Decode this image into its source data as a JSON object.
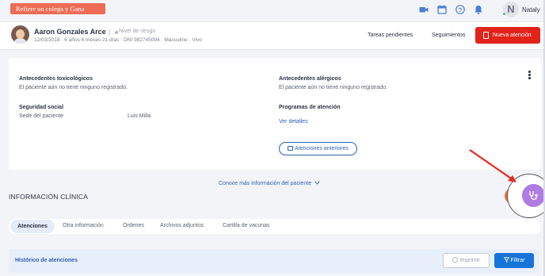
{
  "topnav": {
    "referral_banner": "Refiere un colega y Gana",
    "icons": [
      "video-icon",
      "calendar-icon",
      "help-icon",
      "bell-icon"
    ],
    "user_initial": "N",
    "user_name": "Nataly"
  },
  "patient": {
    "name": "Aaron Gonzales Arce",
    "separator": "|",
    "risk_label": "Nivel de riesgo",
    "meta": "12/03/2018 · 6 años 6 meses 21 días · DNI 982745094 · Masculino · Vivo",
    "pending_tasks": "Tareas pendientes",
    "follow_ups": "Seguimientos",
    "new_attention": "Nueva atención"
  },
  "info": {
    "toxic_title": "Antecedentes toxicológicos",
    "toxic_text": "El paciente aún no tiene ninguno registrado.",
    "allergic_title": "Antecedentes alérgicos",
    "allergic_text": "El paciente aún no tiene ninguno registrado.",
    "social_title": "Seguridad social",
    "social_label": "Sede del paciente",
    "social_value": "Luis Milla",
    "programs_title": "Programas de atención",
    "see_details": "Ver detalles",
    "previous_attentions": "Atenciones anteriores"
  },
  "more_info": "Conoce más información del paciente",
  "clinical_title": "INFORMACIÓN CLÍNICA",
  "tabs": [
    "Atenciones",
    "Otra información",
    "Órdenes",
    "Archivos adjuntos",
    "Cartilla de vacunas"
  ],
  "history": {
    "title": "Histórico de atenciones",
    "print": "Imprimir",
    "filter": "Filtrar"
  },
  "colors": {
    "primary": "#1573d9",
    "danger": "#e2231a",
    "referral": "#ee6b55",
    "assistant": "#b07be3",
    "annotation_arrow": "#e8281c"
  }
}
